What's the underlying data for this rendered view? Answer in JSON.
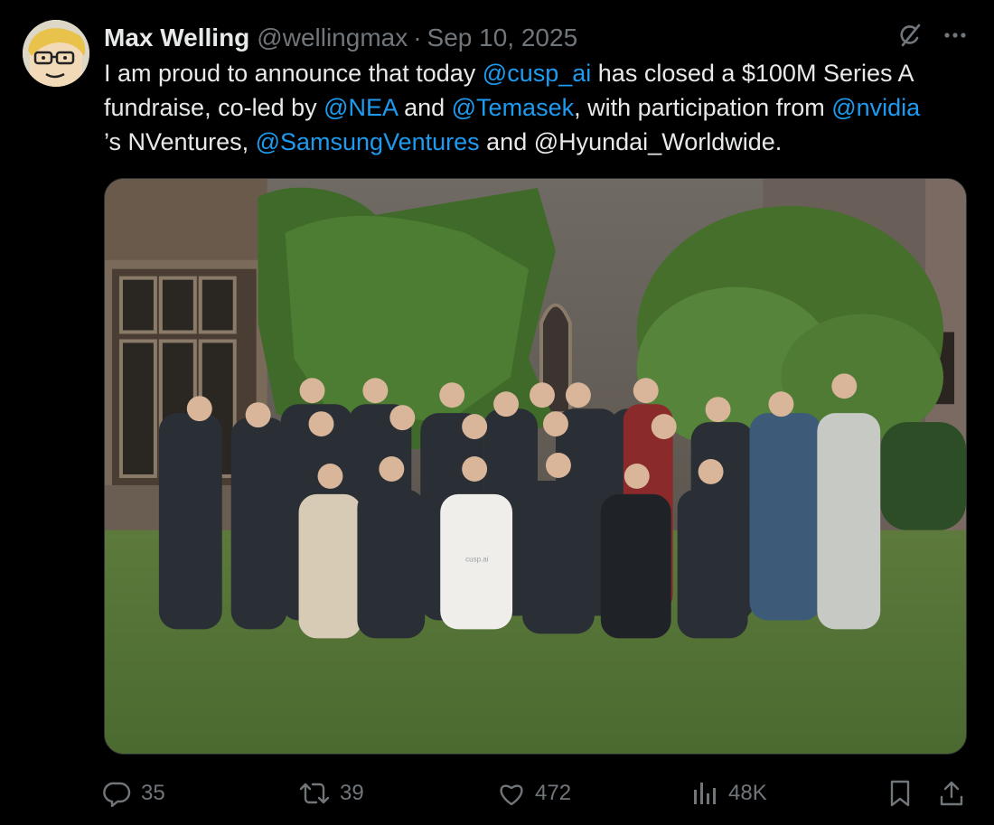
{
  "tweet": {
    "author": {
      "name": "Max Welling",
      "handle": "@wellingmax",
      "separator": "·",
      "date": "Sep 10, 2025"
    },
    "text": {
      "p1": "I am proud to announce that today ",
      "m1": "@cusp_ai",
      "p2": " has closed a $100M Series A fundraise, co-led by ",
      "m2": "@NEA",
      "p3": " and ",
      "m3": "@Temasek",
      "p4": ", with participation from ",
      "m4": "@nvidia",
      "p5": "’s NVentures, ",
      "m5": "@SamsungVentures",
      "p6": " and @Hyundai_Worldwide."
    },
    "media": {
      "shirt_logo_text": "cusp.ai"
    },
    "metrics": {
      "replies": "35",
      "reposts": "39",
      "likes": "472",
      "views": "48K"
    }
  },
  "icons": {
    "grok": "grok-icon",
    "more": "more-icon",
    "reply": "reply-icon",
    "repost": "repost-icon",
    "like": "like-icon",
    "views": "views-icon",
    "bookmark": "bookmark-icon",
    "share": "share-icon"
  },
  "colors": {
    "background": "#000000",
    "text": "#e7e9ea",
    "secondary": "#71767b",
    "link": "#1d9bf0",
    "border": "#2f3336"
  }
}
